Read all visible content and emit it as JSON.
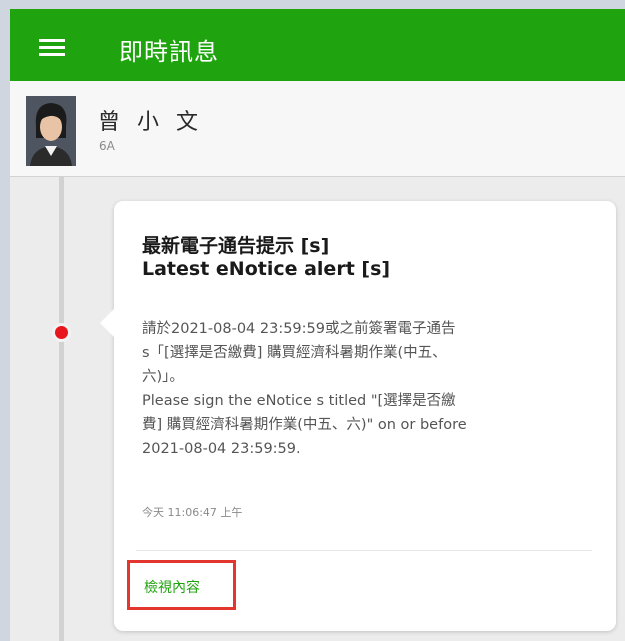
{
  "app_bar": {
    "title": "即時訊息",
    "menu_icon": "hamburger-icon",
    "color": "#1fa40f"
  },
  "user": {
    "name": "曾 小 文",
    "class": "6A",
    "avatar_icon": "avatar-photo"
  },
  "notice": {
    "title_zh": "最新電子通告提示 [s]",
    "title_en": "Latest eNotice alert [s]",
    "body_lines": [
      "請於2021-08-04 23:59:59或之前簽署電子通告",
      "s「[選擇是否繳費] 購買經濟科暑期作業(中五、",
      "六)」。",
      "Please sign the eNotice s titled \"[選擇是否繳",
      "費] 購買經濟科暑期作業(中五、六)\" on or before",
      "2021-08-04 23:59:59."
    ],
    "timestamp": "今天 11:06:47 上午",
    "view_button": "檢視內容",
    "unread_dot_color": "#e8151c",
    "highlight_color": "#e2362f"
  }
}
